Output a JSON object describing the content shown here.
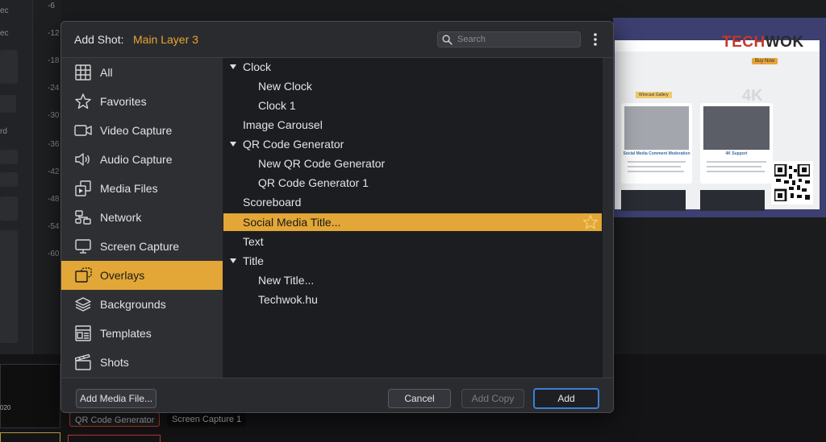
{
  "background": {
    "ruler_ticks": [
      "-6",
      "-12",
      "-18",
      "-24",
      "-30",
      "-36",
      "-42",
      "-48",
      "-54",
      "-60"
    ],
    "side_labels": [
      "ec",
      "ec",
      "rd"
    ],
    "thumb_label": "020",
    "bottom_tabs": [
      "QR Code Generator",
      "Screen Capture 1"
    ]
  },
  "preview": {
    "brand_red": "TECH",
    "brand_dark": "WOK",
    "buy_label": "Buy Now",
    "badge_label": "Wirecast Gallery",
    "card1_title": "Social Media Comment Moderation",
    "card2_title": "4K Support",
    "big_text": "4K"
  },
  "dialog": {
    "title": "Add Shot:",
    "layer_name": "Main Layer 3",
    "search_placeholder": "Search",
    "sidebar": [
      {
        "label": "All",
        "icon": "grid-icon"
      },
      {
        "label": "Favorites",
        "icon": "star-icon"
      },
      {
        "label": "Video Capture",
        "icon": "video-camera-icon"
      },
      {
        "label": "Audio Capture",
        "icon": "speaker-icon"
      },
      {
        "label": "Media Files",
        "icon": "media-files-icon"
      },
      {
        "label": "Network",
        "icon": "network-icon"
      },
      {
        "label": "Screen Capture",
        "icon": "monitor-icon"
      },
      {
        "label": "Overlays",
        "icon": "overlays-icon",
        "active": true
      },
      {
        "label": "Backgrounds",
        "icon": "layers-icon"
      },
      {
        "label": "Templates",
        "icon": "templates-icon"
      },
      {
        "label": "Shots",
        "icon": "clapper-icon"
      }
    ],
    "tree": [
      {
        "label": "Clock",
        "level": 0,
        "expanded": true
      },
      {
        "label": "New Clock",
        "level": 1
      },
      {
        "label": "Clock 1",
        "level": 1
      },
      {
        "label": "Image Carousel",
        "level": 0
      },
      {
        "label": "QR Code Generator",
        "level": 0,
        "expanded": true
      },
      {
        "label": "New QR Code Generator",
        "level": 1
      },
      {
        "label": "QR Code Generator 1",
        "level": 1
      },
      {
        "label": "Scoreboard",
        "level": 0
      },
      {
        "label": "Social Media Title...",
        "level": 0,
        "selected": true
      },
      {
        "label": "Text",
        "level": 0
      },
      {
        "label": "Title",
        "level": 0,
        "expanded": true
      },
      {
        "label": "New Title...",
        "level": 1
      },
      {
        "label": "Techwok.hu",
        "level": 1
      }
    ],
    "buttons": {
      "add_media": "Add Media File...",
      "cancel": "Cancel",
      "add_copy": "Add Copy",
      "add": "Add"
    }
  },
  "colors": {
    "accent": "#e2a736",
    "layer_name": "#e8a52f",
    "focus_ring": "#3d7fd6"
  }
}
